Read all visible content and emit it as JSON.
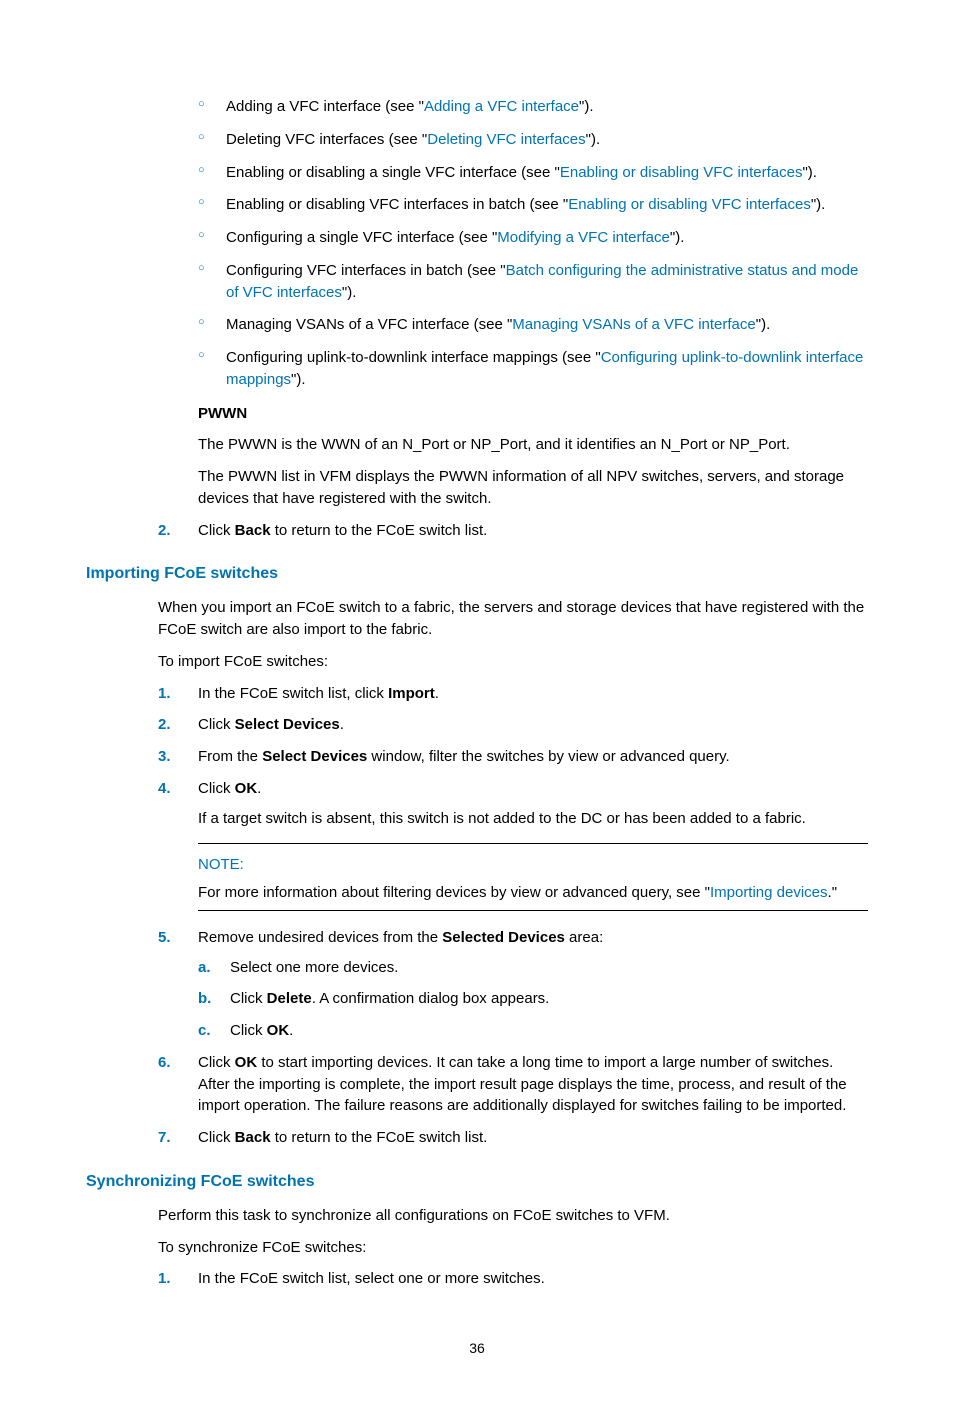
{
  "topList": [
    {
      "pre": "Adding a VFC interface (see \"",
      "link": "Adding a VFC interface",
      "post": "\")."
    },
    {
      "pre": "Deleting VFC interfaces (see \"",
      "link": "Deleting VFC interfaces",
      "post": "\")."
    },
    {
      "pre": "Enabling or disabling a single VFC interface (see \"",
      "link": "Enabling or disabling VFC interfaces",
      "post": "\")."
    },
    {
      "pre": "Enabling or disabling VFC interfaces in batch (see \"",
      "link": "Enabling or disabling VFC interfaces",
      "post": "\")."
    },
    {
      "pre": "Configuring a single VFC interface (see \"",
      "link": "Modifying a VFC interface",
      "post": "\")."
    },
    {
      "pre": "Configuring VFC interfaces in batch (see \"",
      "link": "Batch configuring the administrative status and mode of VFC interfaces",
      "post": "\")."
    },
    {
      "pre": "Managing VSANs of a VFC interface (see \"",
      "link": "Managing VSANs of a VFC interface",
      "post": "\")."
    },
    {
      "pre": "Configuring uplink-to-downlink interface mappings (see \"",
      "link": "Configuring uplink-to-downlink interface mappings",
      "post": "\")."
    }
  ],
  "pwwn": {
    "heading": "PWWN",
    "p1": "The PWWN is the WWN of an N_Port or NP_Port, and it identifies an N_Port or NP_Port.",
    "p2": "The PWWN list in VFM displays the PWWN information of all NPV switches, servers, and storage devices that have registered with the switch."
  },
  "step2": {
    "num": "2.",
    "pre": "Click ",
    "bold": "Back",
    "post": " to return to the FCoE switch list."
  },
  "importing": {
    "heading": "Importing FCoE switches",
    "intro": "When you import an FCoE switch to a fabric, the servers and storage devices that have registered with the FCoE switch are also import to the fabric.",
    "lead": "To import FCoE switches:",
    "steps": {
      "s1": {
        "num": "1.",
        "pre": "In the FCoE switch list, click ",
        "bold": "Import",
        "post": "."
      },
      "s2": {
        "num": "2.",
        "pre": "Click ",
        "bold": "Select Devices",
        "post": "."
      },
      "s3": {
        "num": "3.",
        "pre": "From the ",
        "bold": "Select Devices",
        "post": " window, filter the switches by view or advanced query."
      },
      "s4": {
        "num": "4.",
        "pre": "Click ",
        "bold": "OK",
        "post": ".",
        "extra": "If a target switch is absent, this switch is not added to the DC or has been added to a fabric."
      },
      "s5": {
        "num": "5.",
        "pre": "Remove undesired devices from the ",
        "bold": "Selected Devices",
        "post": " area:",
        "sub": {
          "a": {
            "m": "a.",
            "text": "Select one more devices."
          },
          "b": {
            "m": "b.",
            "pre": "Click ",
            "bold": "Delete",
            "post": ". A confirmation dialog box appears."
          },
          "c": {
            "m": "c.",
            "pre": "Click ",
            "bold": "OK",
            "post": "."
          }
        }
      },
      "s6": {
        "num": "6.",
        "pre": "Click ",
        "bold": "OK",
        "post": " to start importing devices. It can take a long time to import a large number of switches. After the importing is complete, the import result page displays the time, process, and result of the import operation. The failure reasons are additionally displayed for switches failing to be imported."
      },
      "s7": {
        "num": "7.",
        "pre": "Click ",
        "bold": "Back",
        "post": " to return to the FCoE switch list."
      }
    },
    "note": {
      "label": "NOTE:",
      "pre": "For more information about filtering devices by view or advanced query, see \"",
      "link": "Importing devices",
      "post": ".\""
    }
  },
  "sync": {
    "heading": "Synchronizing FCoE switches",
    "p1": "Perform this task to synchronize all configurations on FCoE switches to VFM.",
    "lead": "To synchronize FCoE switches:",
    "s1": {
      "num": "1.",
      "text": "In the FCoE switch list, select one or more switches."
    }
  },
  "pageNumber": "36"
}
